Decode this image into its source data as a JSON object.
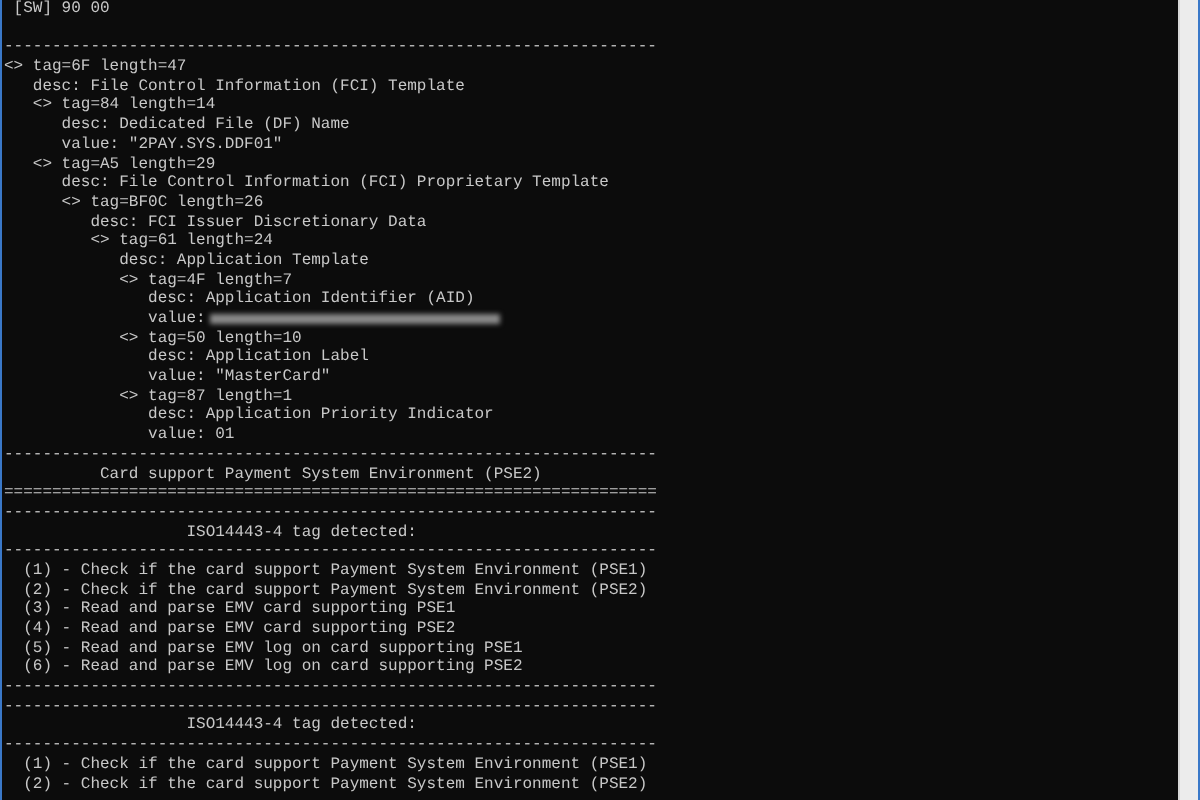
{
  "console": {
    "lines": [
      {
        "kind": "text",
        "text": " [SW] 90 00"
      },
      {
        "kind": "blank"
      },
      {
        "kind": "rule",
        "text": "--------------------------------------------------------------------"
      },
      {
        "kind": "text",
        "text": "<> tag=6F length=47"
      },
      {
        "kind": "text",
        "text": "   desc: File Control Information (FCI) Template"
      },
      {
        "kind": "text",
        "text": "   <> tag=84 length=14"
      },
      {
        "kind": "text",
        "text": "      desc: Dedicated File (DF) Name"
      },
      {
        "kind": "text",
        "text": "      value: \"2PAY.SYS.DDF01\""
      },
      {
        "kind": "text",
        "text": "   <> tag=A5 length=29"
      },
      {
        "kind": "text",
        "text": "      desc: File Control Information (FCI) Proprietary Template"
      },
      {
        "kind": "text",
        "text": "      <> tag=BF0C length=26"
      },
      {
        "kind": "text",
        "text": "         desc: FCI Issuer Discretionary Data"
      },
      {
        "kind": "text",
        "text": "         <> tag=61 length=24"
      },
      {
        "kind": "text",
        "text": "            desc: Application Template"
      },
      {
        "kind": "text",
        "text": "            <> tag=4F length=7"
      },
      {
        "kind": "text",
        "text": "               desc: Application Identifier (AID)"
      },
      {
        "kind": "redacted",
        "text": "               value:"
      },
      {
        "kind": "text",
        "text": "            <> tag=50 length=10"
      },
      {
        "kind": "text",
        "text": "               desc: Application Label"
      },
      {
        "kind": "text",
        "text": "               value: \"MasterCard\""
      },
      {
        "kind": "text",
        "text": "            <> tag=87 length=1"
      },
      {
        "kind": "text",
        "text": "               desc: Application Priority Indicator"
      },
      {
        "kind": "text",
        "text": "               value: 01"
      },
      {
        "kind": "rule",
        "text": "--------------------------------------------------------------------"
      },
      {
        "kind": "text",
        "text": "          Card support Payment System Environment (PSE2)"
      },
      {
        "kind": "rule",
        "text": "===================================================================="
      },
      {
        "kind": "rule",
        "text": "--------------------------------------------------------------------"
      },
      {
        "kind": "text",
        "text": "                   ISO14443-4 tag detected:"
      },
      {
        "kind": "rule",
        "text": "--------------------------------------------------------------------"
      },
      {
        "kind": "text",
        "text": "  (1) - Check if the card support Payment System Environment (PSE1)"
      },
      {
        "kind": "text",
        "text": "  (2) - Check if the card support Payment System Environment (PSE2)"
      },
      {
        "kind": "text",
        "text": "  (3) - Read and parse EMV card supporting PSE1"
      },
      {
        "kind": "text",
        "text": "  (4) - Read and parse EMV card supporting PSE2"
      },
      {
        "kind": "text",
        "text": "  (5) - Read and parse EMV log on card supporting PSE1"
      },
      {
        "kind": "text",
        "text": "  (6) - Read and parse EMV log on card supporting PSE2"
      },
      {
        "kind": "rule",
        "text": "--------------------------------------------------------------------"
      },
      {
        "kind": "rule",
        "text": "--------------------------------------------------------------------"
      },
      {
        "kind": "text",
        "text": "                   ISO14443-4 tag detected:"
      },
      {
        "kind": "rule",
        "text": "--------------------------------------------------------------------"
      },
      {
        "kind": "text",
        "text": "  (1) - Check if the card support Payment System Environment (PSE1)"
      },
      {
        "kind": "text",
        "text": "  (2) - Check if the card support Payment System Environment (PSE2)"
      }
    ]
  }
}
